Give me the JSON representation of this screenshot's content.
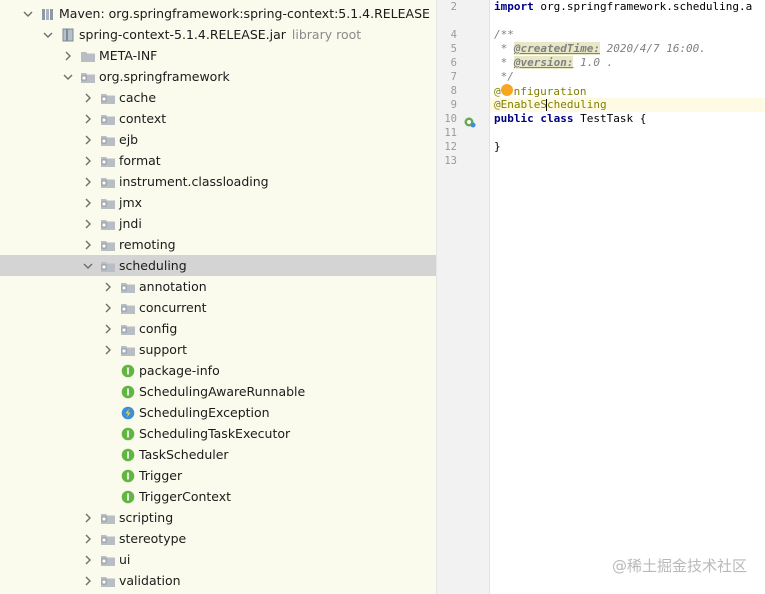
{
  "tree": {
    "rows": [
      {
        "label": "Maven: org.springframework:spring-context:5.1.4.RELEASE",
        "type": "library",
        "expanded": true,
        "indent": 0
      },
      {
        "label": "spring-context-5.1.4.RELEASE.jar",
        "suffix": "library root",
        "type": "jar",
        "expanded": true,
        "indent": 1
      },
      {
        "label": "META-INF",
        "type": "folder",
        "expanded": false,
        "indent": 2
      },
      {
        "label": "org.springframework",
        "type": "package",
        "expanded": true,
        "indent": 2
      },
      {
        "label": "cache",
        "type": "package",
        "expanded": false,
        "indent": 3
      },
      {
        "label": "context",
        "type": "package",
        "expanded": false,
        "indent": 3
      },
      {
        "label": "ejb",
        "type": "package",
        "expanded": false,
        "indent": 3
      },
      {
        "label": "format",
        "type": "package",
        "expanded": false,
        "indent": 3
      },
      {
        "label": "instrument.classloading",
        "type": "package",
        "expanded": false,
        "indent": 3
      },
      {
        "label": "jmx",
        "type": "package",
        "expanded": false,
        "indent": 3
      },
      {
        "label": "jndi",
        "type": "package",
        "expanded": false,
        "indent": 3
      },
      {
        "label": "remoting",
        "type": "package",
        "expanded": false,
        "indent": 3
      },
      {
        "label": "scheduling",
        "type": "package",
        "expanded": true,
        "indent": 3,
        "selected": true
      },
      {
        "label": "annotation",
        "type": "package",
        "expanded": false,
        "indent": 4
      },
      {
        "label": "concurrent",
        "type": "package",
        "expanded": false,
        "indent": 4
      },
      {
        "label": "config",
        "type": "package",
        "expanded": false,
        "indent": 4
      },
      {
        "label": "support",
        "type": "package",
        "expanded": false,
        "indent": 4
      },
      {
        "label": "package-info",
        "type": "interface",
        "indent": 4
      },
      {
        "label": "SchedulingAwareRunnable",
        "type": "interface",
        "indent": 4
      },
      {
        "label": "SchedulingException",
        "type": "exception",
        "indent": 4
      },
      {
        "label": "SchedulingTaskExecutor",
        "type": "interface",
        "indent": 4
      },
      {
        "label": "TaskScheduler",
        "type": "interface",
        "indent": 4
      },
      {
        "label": "Trigger",
        "type": "interface",
        "indent": 4
      },
      {
        "label": "TriggerContext",
        "type": "interface",
        "indent": 4
      },
      {
        "label": "scripting",
        "type": "package",
        "expanded": false,
        "indent": 3
      },
      {
        "label": "stereotype",
        "type": "package",
        "expanded": false,
        "indent": 3
      },
      {
        "label": "ui",
        "type": "package",
        "expanded": false,
        "indent": 3
      },
      {
        "label": "validation",
        "type": "package",
        "expanded": false,
        "indent": 3
      }
    ]
  },
  "editor": {
    "line_numbers": [
      "2",
      "",
      "4",
      "5",
      "6",
      "7",
      "8",
      "9",
      "10",
      "11",
      "12",
      "13"
    ],
    "lines": {
      "import_kw": "import",
      "import_rest": " org.springframework.scheduling.a",
      "doc_open": "/**",
      "created_star": " * ",
      "created_tag": "@createdTime:",
      "created_val": " 2020/4/7 16:00.",
      "version_star": " * ",
      "version_tag": "@version:",
      "version_val": " 1.0 .",
      "doc_close": " */",
      "config_at": "@",
      "config_rest": "nfiguration",
      "enable_a": "@EnableS",
      "enable_b": "cheduling",
      "class_public": "public",
      "class_sp1": " ",
      "class_class": "class",
      "class_name": " TestTask {",
      "brace_close": "}"
    }
  },
  "watermark": "@稀土掘金技术社区",
  "colors": {
    "tree_bg": "#fafbec",
    "selected_row": "#d4d4d4",
    "keyword": "#000080",
    "comment": "#808080",
    "annotation": "#808000",
    "interface_icon": "#62b543",
    "exception_icon": "#3d8fd8"
  }
}
